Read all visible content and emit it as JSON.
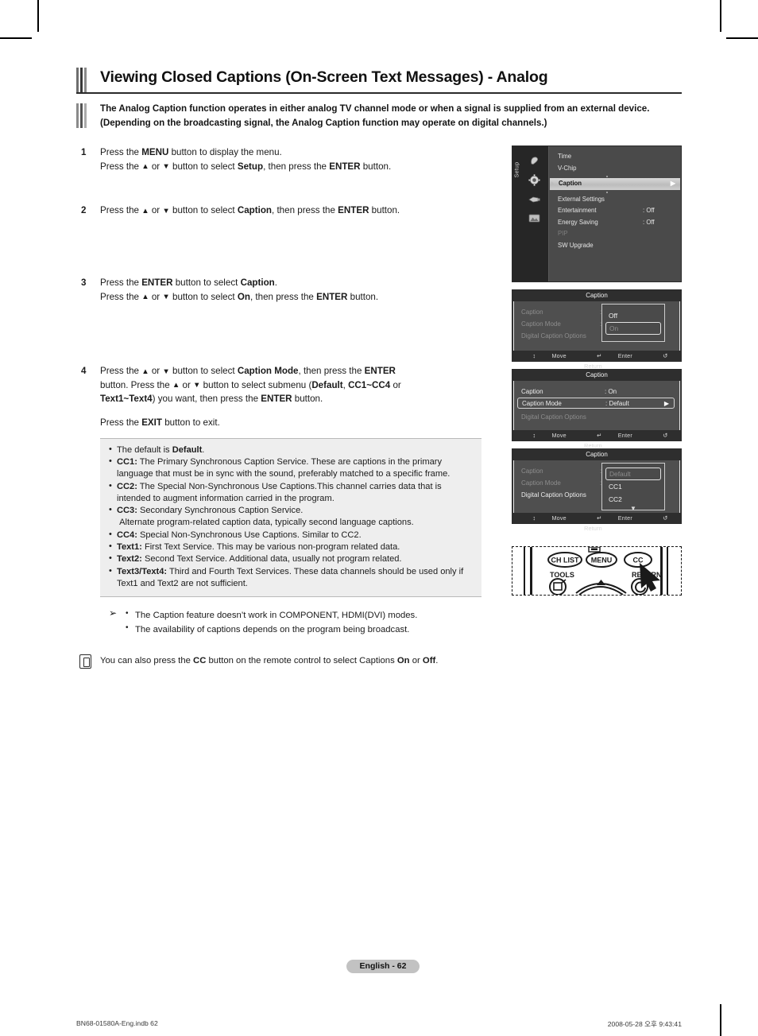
{
  "page": {
    "title": "Viewing Closed Captions (On-Screen Text Messages) - Analog",
    "intro": "The Analog Caption function operates in either analog TV channel mode or when a signal is supplied from an external device. (Depending on the broadcasting signal, the Analog Caption function may operate on digital channels.)",
    "page_badge": "English - 62",
    "footer_left": "BN68-01580A-Eng.indb   62",
    "footer_right": "2008-05-28   오후 9:43:41"
  },
  "steps": [
    {
      "num": "1",
      "lines": [
        "Press the <b>MENU</b> button to display the menu.",
        "Press the <span class=\"tri\">▲</span> or <span class=\"tri\">▼</span> button to select <b>Setup</b>, then press the <b>ENTER</b> button."
      ]
    },
    {
      "num": "2",
      "lines": [
        "Press the <span class=\"tri\">▲</span> or <span class=\"tri\">▼</span> button to select <b>Caption</b>, then press the <b>ENTER</b> button."
      ]
    },
    {
      "num": "3",
      "lines": [
        "Press the <b>ENTER</b> button to select <b>Caption</b>.",
        "Press the <span class=\"tri\">▲</span> or <span class=\"tri\">▼</span> button to select <b>On</b>, then press the <b>ENTER</b> button."
      ]
    },
    {
      "num": "4",
      "lines": [
        "Press the <span class=\"tri\">▲</span> or <span class=\"tri\">▼</span> button to select <b>Caption Mode</b>, then press the <b>ENTER</b>",
        "button. Press the <span class=\"tri\">▲</span> or <span class=\"tri\">▼</span> button to select submenu (<b>Default</b>, <b>CC1~CC4</b> or",
        "<b>Text1~Text4</b>) you want, then press the <b>ENTER</b> button.",
        "",
        "Press the <b>EXIT</b> button to exit."
      ]
    }
  ],
  "infobox": {
    "items": [
      "The default is <b>Default</b>.",
      "<b>CC1:</b> The Primary Synchronous Caption Service. These are captions in the primary language that must be in sync with the sound, preferably matched to a specific frame.",
      "<b>CC2:</b> The Special Non-Synchronous Use Captions.This channel carries data that is intended to augment information carried in the program.",
      "<b>CC3:</b> Secondary Synchronous Caption Service.<br>&nbsp;Alternate program-related caption data, typically second language captions.",
      "<b>CC4:</b> Special Non-Synchronous Use Captions. Similar to CC2.",
      "<b>Text1:</b> First Text Service. This may be various non-program related data.",
      "<b>Text2:</b> Second Text Service. Additional data, usually not program related.",
      "<b>Text3/Text4:</b> Third and Fourth Text Services. These data channels should be used only if Text1 and Text2 are not sufficient."
    ]
  },
  "notes": {
    "arrow_glyph": "➢",
    "items": [
      "The Caption feature doesn’t work in COMPONENT, HDMI(DVI) modes.",
      "The availability of captions depends on the program being broadcast."
    ],
    "tip": "You can also press the <b>CC</b> button on the remote control to select Captions <b>On</b> or <b>Off</b>."
  },
  "osd": {
    "setup_panel": {
      "rail_label": "Setup",
      "rows": [
        {
          "label": "Time",
          "value": "",
          "state": "normal"
        },
        {
          "label": "V-Chip",
          "value": "",
          "state": "normal"
        },
        {
          "label": "Caption",
          "value": "",
          "state": "selected"
        },
        {
          "label": "External Settings",
          "value": "",
          "state": "normal"
        },
        {
          "label": "Entertainment",
          "value": ": Off",
          "state": "normal"
        },
        {
          "label": "Energy Saving",
          "value": ": Off",
          "state": "normal"
        },
        {
          "label": "PIP",
          "value": "",
          "state": "dim"
        },
        {
          "label": "SW Upgrade",
          "value": "",
          "state": "normal"
        }
      ]
    },
    "panel_caption_onoff": {
      "title": "Caption",
      "rows": [
        {
          "label": "Caption",
          "value": "",
          "state": "dim"
        },
        {
          "label": "Caption Mode",
          "value": "",
          "state": "dim"
        },
        {
          "label": "Digital Caption Options",
          "value": "",
          "state": "dim"
        }
      ],
      "dropdown": {
        "options": [
          "Off",
          "On"
        ],
        "selected": "On"
      },
      "footer": {
        "move": "Move",
        "enter": "Enter",
        "return": "Return"
      }
    },
    "panel_caption_on": {
      "title": "Caption",
      "rows": [
        {
          "label": "Caption",
          "value": ": On",
          "state": "normal"
        },
        {
          "label": "Caption Mode",
          "value": ": Default",
          "state": "selected"
        },
        {
          "label": "Digital Caption Options",
          "value": "",
          "state": "dim"
        }
      ],
      "footer": {
        "move": "Move",
        "enter": "Enter",
        "return": "Return"
      }
    },
    "panel_caption_mode": {
      "title": "Caption",
      "rows": [
        {
          "label": "Caption",
          "value": "",
          "state": "dim"
        },
        {
          "label": "Caption Mode",
          "value": "",
          "state": "dim"
        },
        {
          "label": "Digital Caption Options",
          "value": "",
          "state": "normal"
        }
      ],
      "dropdown": {
        "options": [
          "Default",
          "CC1",
          "CC2"
        ],
        "selected": "Default",
        "more_glyph": "▼"
      },
      "footer": {
        "move": "Move",
        "enter": "Enter",
        "return": "Return"
      }
    }
  },
  "remote": {
    "buttons": [
      {
        "name": "ch-list-button",
        "label": "CH LIST"
      },
      {
        "name": "menu-button",
        "label": "MENU"
      },
      {
        "name": "cc-button",
        "label": "CC"
      }
    ],
    "labels": [
      {
        "name": "tools-label",
        "label": "TOOLS"
      },
      {
        "name": "return-label",
        "label": "RETURN"
      }
    ]
  }
}
